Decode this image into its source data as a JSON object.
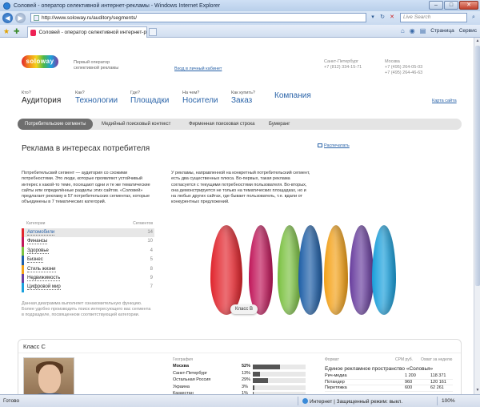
{
  "window": {
    "title": "Соловей - оператор селективной интернет-рекламы - Windows Internet Explorer",
    "url": "http://www.soloway.ru/auditory/segments/",
    "search_placeholder": "Live Search",
    "tab_title": "Соловей - оператор селективной интернет-ре...",
    "cmd_page": "Страница",
    "cmd_tools": "Сервис",
    "status_done": "Готово",
    "status_zone": "Интернет | Защищенный режим: выкл.",
    "zoom": "100%"
  },
  "header": {
    "logo": "soloway",
    "tagline": "Первый оператор селективной рекламы",
    "cabinet_link": "Вход в личный кабинет",
    "city1": {
      "name": "Санкт-Петербург",
      "phone1": "+7 (812) 334-15-71"
    },
    "city2": {
      "name": "Москва",
      "phone1": "+7 (495) 264-05-03",
      "phone2": "+7 (495) 264-46-63"
    }
  },
  "nav": [
    {
      "q": "Кто?",
      "label": "Аудитория"
    },
    {
      "q": "Как?",
      "label": "Технологии"
    },
    {
      "q": "Где?",
      "label": "Площадки"
    },
    {
      "q": "На чем?",
      "label": "Носители"
    },
    {
      "q": "Как купить?",
      "label": "Заказ"
    },
    {
      "q": "",
      "label": "Компания"
    }
  ],
  "sitemap": "Карта сайта",
  "subnav": [
    "Потребительские сегменты",
    "Медийный поисковый контекст",
    "Фирменная поисковая строка",
    "Бумеранг"
  ],
  "page": {
    "title": "Реклама в интересах потребителя",
    "print": "Распечатать",
    "intro_left": "Потребительский сегмент — аудитория со схожими потребностями. Это люди, которые проявляют устойчивый интерес к какой-то теме, посещают одни и те же тематические сайты или определённые разделы этих сайтов. «Соловей» предлагает рекламу в 57 потребительских сегментах, которые объединены в 7 тематических категорий.",
    "intro_right": "У рекламы, направленной на конкретный потребительский сегмент, есть два существенных плюса. Во-первых, такая реклама согласуется с текущими потребностями пользователя. Во-вторых, она демонстрируется не только на тематических площадках, но и на любых других сайтах, где бывает пользователь, т.е. вдали от конкурентных предложений.",
    "cat_header_left": "Категории",
    "cat_header_right": "Сегментов",
    "categories": [
      {
        "name": "Автомобили",
        "count": "14",
        "color": "#e2262e"
      },
      {
        "name": "Финансы",
        "count": "10",
        "color": "#c2185b"
      },
      {
        "name": "Здоровье",
        "count": "4",
        "color": "#7cc242"
      },
      {
        "name": "Бизнес",
        "count": "5",
        "color": "#1e5fa8"
      },
      {
        "name": "Стиль жизни",
        "count": "8",
        "color": "#f5a31a"
      },
      {
        "name": "Недвижимость",
        "count": "9",
        "color": "#6a3fa0"
      },
      {
        "name": "Цифровой мир",
        "count": "7",
        "color": "#1ba1dd"
      }
    ],
    "cat_note": "Данная диаграмма выполняет ознакомительную функцию. Более удобно производить поиск интересующего вас сегмента в подразделе, посвященном соответствующей категории.",
    "class_button": "Класс В"
  },
  "panel": {
    "title": "Класс С",
    "geo_header": "География",
    "geo": [
      {
        "name": "Москва",
        "pct": "52%",
        "value": 0.52
      },
      {
        "name": "Санкт-Петербург",
        "pct": "13%",
        "value": 0.13
      },
      {
        "name": "Остальная Россия",
        "pct": "29%",
        "value": 0.29
      },
      {
        "name": "Украина",
        "pct": "3%",
        "value": 0.03
      },
      {
        "name": "Казахстан",
        "pct": "1%",
        "value": 0.01
      }
    ],
    "fmt_header": {
      "format": "Формат",
      "cpm": "CPM руб.",
      "reach": "Охват за неделю"
    },
    "fmt_title": "Единое рекламное пространство «Соловья»",
    "formats": [
      {
        "name": "Рич-медиа",
        "cpm": "1 200",
        "reach": "118 371"
      },
      {
        "name": "Потандер",
        "cpm": "960",
        "reach": "120 161"
      },
      {
        "name": "Перетяжка",
        "cpm": "600",
        "reach": "62 261"
      }
    ]
  }
}
